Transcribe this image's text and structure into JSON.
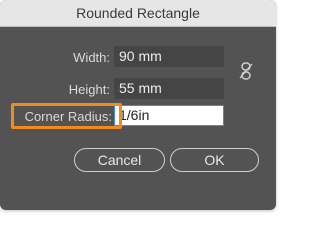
{
  "dialog": {
    "title": "Rounded Rectangle",
    "width_label": "Width:",
    "width_value": "90 mm",
    "height_label": "Height:",
    "height_value": "55 mm",
    "radius_label": "Corner Radius:",
    "radius_value": "1/6in",
    "link_icon": "unlinked-chain-icon",
    "cancel_label": "Cancel",
    "ok_label": "OK"
  },
  "colors": {
    "panel": "#535353",
    "titlebar": "#e6e6e6",
    "field": "#454545",
    "highlight": "#f08c1e",
    "focus": "#3d8ee0"
  }
}
